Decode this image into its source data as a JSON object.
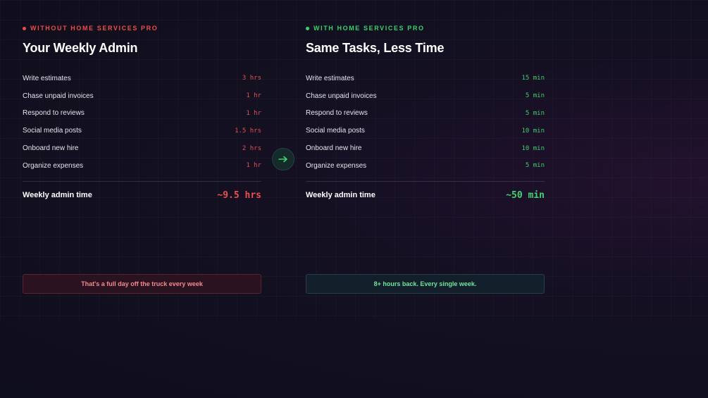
{
  "without": {
    "eyebrow": "WITHOUT HOME SERVICES PRO",
    "title": "Your Weekly Admin",
    "tasks": [
      {
        "label": "Write estimates",
        "value": "3 hrs"
      },
      {
        "label": "Chase unpaid invoices",
        "value": "1 hr"
      },
      {
        "label": "Respond to reviews",
        "value": "1 hr"
      },
      {
        "label": "Social media posts",
        "value": "1.5 hrs"
      },
      {
        "label": "Onboard new hire",
        "value": "2 hrs"
      },
      {
        "label": "Organize expenses",
        "value": "1 hr"
      }
    ],
    "total_label": "Weekly admin time",
    "total_value": "~9.5 hrs",
    "callout": "That's a full day off the truck every week"
  },
  "with": {
    "eyebrow": "WITH HOME SERVICES PRO",
    "title": "Same Tasks, Less Time",
    "tasks": [
      {
        "label": "Write estimates",
        "value": "15 min"
      },
      {
        "label": "Chase unpaid invoices",
        "value": "5 min"
      },
      {
        "label": "Respond to reviews",
        "value": "5 min"
      },
      {
        "label": "Social media posts",
        "value": "10 min"
      },
      {
        "label": "Onboard new hire",
        "value": "10 min"
      },
      {
        "label": "Organize expenses",
        "value": "5 min"
      }
    ],
    "total_label": "Weekly admin time",
    "total_value": "~50 min",
    "callout": "8+ hours back. Every single week."
  },
  "divider_icon": "arrow-right-icon",
  "colors": {
    "negative": "#ef4b48",
    "positive": "#35d36a",
    "background": "#0f0e1c"
  }
}
